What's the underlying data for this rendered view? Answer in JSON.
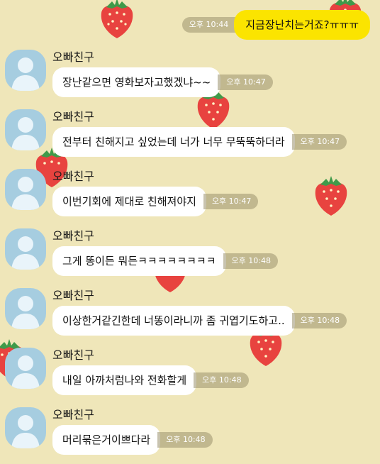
{
  "sent_message": {
    "text": "지금장난치는거죠?ㅠㅠㅠ",
    "time": "오후 10:44"
  },
  "messages": [
    {
      "sender": "오빠친구",
      "text": "장난같으면 영화보자고했겠냐~~",
      "time": "오후 10:47"
    },
    {
      "sender": "오빠친구",
      "text": "전부터 친해지고 싶었는데 너가 너무 무뚝뚝하더라",
      "time": "오후 10:47"
    },
    {
      "sender": "오빠친구",
      "text": "이번기회에 제대로 친해져야지",
      "time": "오후 10:47"
    },
    {
      "sender": "오빠친구",
      "text": "그게 똥이든 뭐든ㅋㅋㅋㅋㅋㅋㅋㅋ",
      "time": "오후 10:48"
    },
    {
      "sender": "오빠친구",
      "text": "이상한거같긴한데 너똥이라니까 좀 귀엽기도하고..",
      "time": "오후 10:48"
    },
    {
      "sender": "오빠친구",
      "text": "내일 아까처럼나와 전화할게",
      "time": "오후 10:48"
    },
    {
      "sender": "오빠친구",
      "text": "머리묶은거이쁘다라",
      "time": "오후 10:48"
    }
  ],
  "avatar_icon": "default-profile-icon",
  "wallpaper_icon": "strawberry-icon",
  "colors": {
    "background": "#efe6b9",
    "my_bubble": "#fbe400",
    "their_bubble": "#ffffff",
    "avatar": "#a6cde0",
    "strawberry": "#e8433f"
  }
}
